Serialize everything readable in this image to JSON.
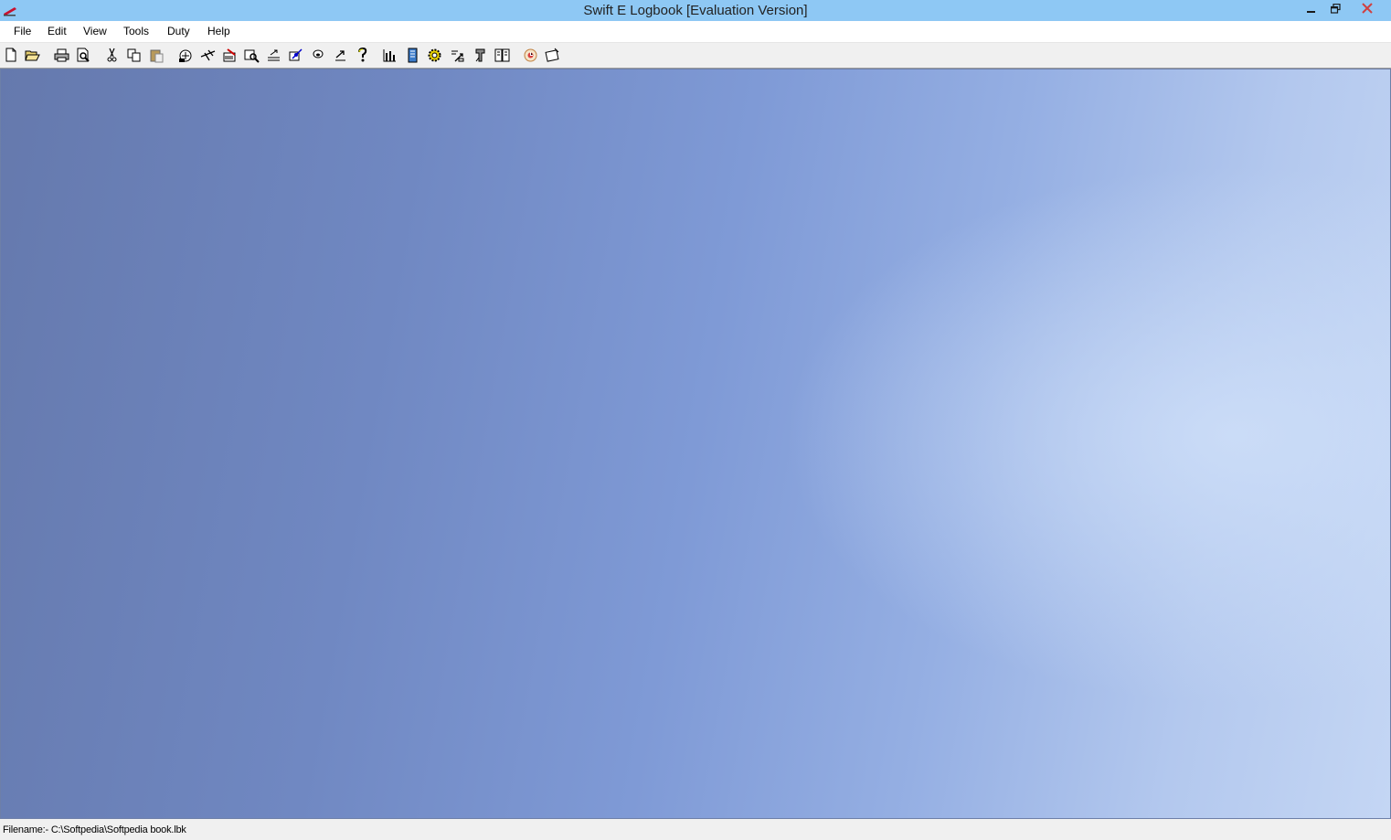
{
  "window": {
    "title": "Swift E Logbook [Evaluation Version]"
  },
  "menu": {
    "items": [
      "File",
      "Edit",
      "View",
      "Tools",
      "Duty",
      "Help"
    ]
  },
  "toolbar": {
    "icons": [
      "new-file-icon",
      "open-folder-icon",
      "print-icon",
      "print-preview-icon",
      "cut-icon",
      "copy-icon",
      "paste-icon",
      "logbook-icon",
      "flight-icon",
      "aircraft-icon",
      "search-icon",
      "import-icon",
      "export-icon",
      "database-icon",
      "arrow-icon",
      "help-icon",
      "chart-icon",
      "book-icon",
      "settings-gear-icon",
      "tools-icon",
      "report-icon",
      "duty-icon",
      "clock-icon",
      "notes-icon"
    ]
  },
  "status": {
    "filename": "Filename:- C:\\Softpedia\\Softpedia book.lbk"
  },
  "colors": {
    "titlebar": "#8ec8f4",
    "close_x": "#d04040"
  }
}
